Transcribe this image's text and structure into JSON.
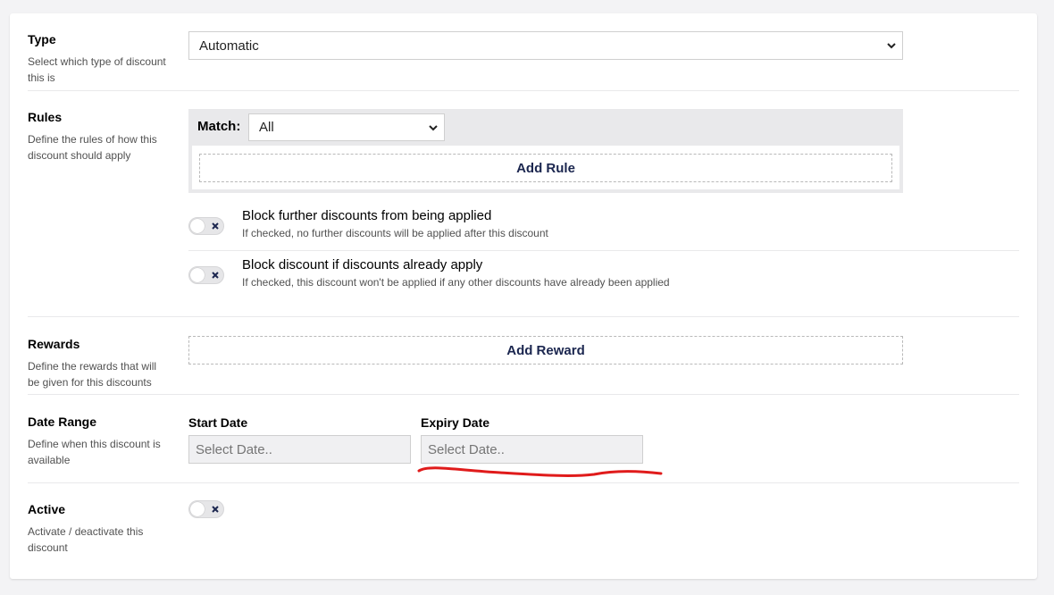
{
  "type_section": {
    "title": "Type",
    "description": "Select which type of discount this is",
    "selected": "Automatic"
  },
  "rules_section": {
    "title": "Rules",
    "description": "Define the rules of how this discount should apply",
    "match_label": "Match:",
    "match_selected": "All",
    "add_rule_label": "Add Rule"
  },
  "options": [
    {
      "title": "Block further discounts from being applied",
      "description": "If checked, no further discounts will be applied after this discount",
      "checked": false
    },
    {
      "title": "Block discount if discounts already apply",
      "description": "If checked, this discount won't be applied if any other discounts have already been applied",
      "checked": false
    }
  ],
  "rewards_section": {
    "title": "Rewards",
    "description": "Define the rewards that will be given for this discounts",
    "add_reward_label": "Add Reward"
  },
  "date_section": {
    "title": "Date Range",
    "description": "Define when this discount is available",
    "start_label": "Start Date",
    "start_placeholder": "Select Date..",
    "expiry_label": "Expiry Date",
    "expiry_placeholder": "Select Date.."
  },
  "active_section": {
    "title": "Active",
    "description": "Activate / deactivate this discount",
    "checked": false
  },
  "colors": {
    "accent_text": "#1b264f",
    "annotation": "#e01b1b"
  },
  "icons": {
    "select_arrow": "chevron-down-icon",
    "toggle_off": "close-icon"
  }
}
